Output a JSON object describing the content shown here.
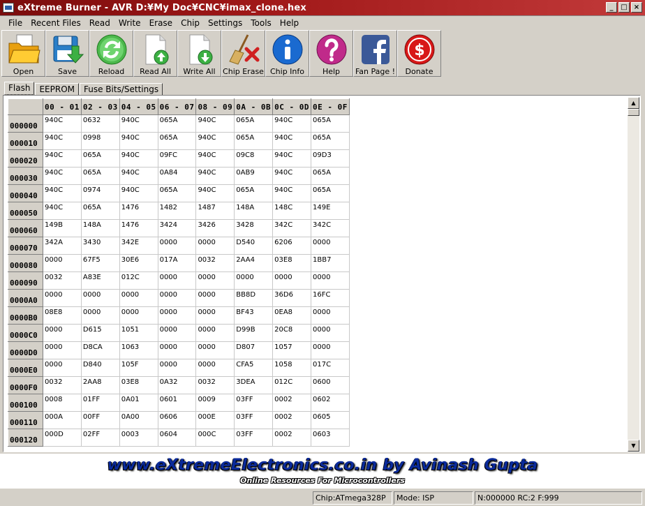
{
  "window": {
    "title": "eXtreme Burner - AVR D:¥My Doc¥CNC¥imax_clone.hex",
    "minimize": "_",
    "maximize": "□",
    "close": "×"
  },
  "menu": [
    "File",
    "Recent Files",
    "Read",
    "Write",
    "Erase",
    "Chip",
    "Settings",
    "Tools",
    "Help"
  ],
  "toolbar": [
    {
      "label": "Open",
      "icon": "folder-open-icon"
    },
    {
      "label": "Save",
      "icon": "save-disk-icon"
    },
    {
      "label": "Reload",
      "icon": "reload-icon"
    },
    {
      "label": "Read All",
      "icon": "read-all-icon"
    },
    {
      "label": "Write All",
      "icon": "write-all-icon"
    },
    {
      "label": "Chip Erase",
      "icon": "broom-erase-icon"
    },
    {
      "label": "Chip Info",
      "icon": "info-icon"
    },
    {
      "label": "Help",
      "icon": "help-icon"
    },
    {
      "label": "Fan Page !",
      "icon": "facebook-icon"
    },
    {
      "label": "Donate",
      "icon": "dollar-icon"
    }
  ],
  "tabs": [
    {
      "label": "Flash",
      "active": true
    },
    {
      "label": "EEPROM",
      "active": false
    },
    {
      "label": "Fuse Bits/Settings",
      "active": false
    }
  ],
  "grid": {
    "columns": [
      "00 - 01",
      "02 - 03",
      "04 - 05",
      "06 - 07",
      "08 - 09",
      "0A - 0B",
      "0C - 0D",
      "0E - 0F"
    ],
    "rows": [
      {
        "addr": "000000",
        "cells": [
          "940C",
          "0632",
          "940C",
          "065A",
          "940C",
          "065A",
          "940C",
          "065A"
        ]
      },
      {
        "addr": "000010",
        "cells": [
          "940C",
          "0998",
          "940C",
          "065A",
          "940C",
          "065A",
          "940C",
          "065A"
        ]
      },
      {
        "addr": "000020",
        "cells": [
          "940C",
          "065A",
          "940C",
          "09FC",
          "940C",
          "09C8",
          "940C",
          "09D3"
        ]
      },
      {
        "addr": "000030",
        "cells": [
          "940C",
          "065A",
          "940C",
          "0A84",
          "940C",
          "0AB9",
          "940C",
          "065A"
        ]
      },
      {
        "addr": "000040",
        "cells": [
          "940C",
          "0974",
          "940C",
          "065A",
          "940C",
          "065A",
          "940C",
          "065A"
        ]
      },
      {
        "addr": "000050",
        "cells": [
          "940C",
          "065A",
          "1476",
          "1482",
          "1487",
          "148A",
          "148C",
          "149E"
        ]
      },
      {
        "addr": "000060",
        "cells": [
          "149B",
          "148A",
          "1476",
          "3424",
          "3426",
          "3428",
          "342C",
          "342C"
        ]
      },
      {
        "addr": "000070",
        "cells": [
          "342A",
          "3430",
          "342E",
          "0000",
          "0000",
          "D540",
          "6206",
          "0000"
        ]
      },
      {
        "addr": "000080",
        "cells": [
          "0000",
          "67F5",
          "30E6",
          "017A",
          "0032",
          "2AA4",
          "03E8",
          "1BB7"
        ]
      },
      {
        "addr": "000090",
        "cells": [
          "0032",
          "A83E",
          "012C",
          "0000",
          "0000",
          "0000",
          "0000",
          "0000"
        ]
      },
      {
        "addr": "0000A0",
        "cells": [
          "0000",
          "0000",
          "0000",
          "0000",
          "0000",
          "BB8D",
          "36D6",
          "16FC"
        ]
      },
      {
        "addr": "0000B0",
        "cells": [
          "08E8",
          "0000",
          "0000",
          "0000",
          "0000",
          "BF43",
          "0EA8",
          "0000"
        ]
      },
      {
        "addr": "0000C0",
        "cells": [
          "0000",
          "D615",
          "1051",
          "0000",
          "0000",
          "D99B",
          "20C8",
          "0000"
        ]
      },
      {
        "addr": "0000D0",
        "cells": [
          "0000",
          "D8CA",
          "1063",
          "0000",
          "0000",
          "D807",
          "1057",
          "0000"
        ]
      },
      {
        "addr": "0000E0",
        "cells": [
          "0000",
          "D840",
          "105F",
          "0000",
          "0000",
          "CFA5",
          "1058",
          "017C"
        ]
      },
      {
        "addr": "0000F0",
        "cells": [
          "0032",
          "2AA8",
          "03E8",
          "0A32",
          "0032",
          "3DEA",
          "012C",
          "0600"
        ]
      },
      {
        "addr": "000100",
        "cells": [
          "0008",
          "01FF",
          "0A01",
          "0601",
          "0009",
          "03FF",
          "0002",
          "0602"
        ]
      },
      {
        "addr": "000110",
        "cells": [
          "000A",
          "00FF",
          "0A00",
          "0606",
          "000E",
          "03FF",
          "0002",
          "0605"
        ]
      },
      {
        "addr": "000120",
        "cells": [
          "000D",
          "02FF",
          "0003",
          "0604",
          "000C",
          "03FF",
          "0002",
          "0603"
        ]
      }
    ]
  },
  "banner": {
    "main": "www.eXtremeElectronics.co.in by Avinash Gupta",
    "sub": "Online Resources For Microcontrollers"
  },
  "status": {
    "chip": "Chip:ATmega328P",
    "mode": "Mode: ISP",
    "info": "N:000000 RC:2 F:999"
  },
  "scroll": {
    "up": "▲",
    "down": "▼"
  }
}
